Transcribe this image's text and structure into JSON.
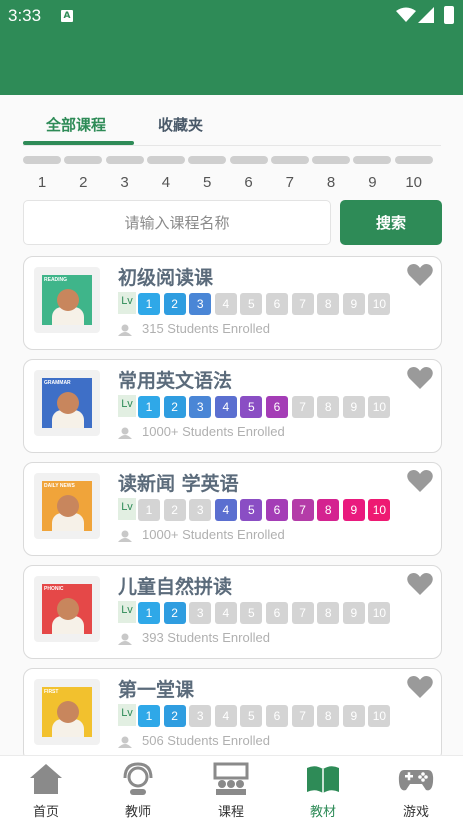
{
  "status_bar": {
    "time": "3:33",
    "notification_icon": "A"
  },
  "tabs": [
    {
      "label": "全部课程",
      "active": true
    },
    {
      "label": "收藏夹",
      "active": false
    }
  ],
  "level_filter": {
    "levels": [
      "1",
      "2",
      "3",
      "4",
      "5",
      "6",
      "7",
      "8",
      "9",
      "10"
    ]
  },
  "search": {
    "placeholder": "请输入课程名称",
    "button_label": "搜索"
  },
  "colors": {
    "brand": "#2e8b57",
    "lv1": "#2fa8e8",
    "lv2": "#2f9de0",
    "lv3": "#4a86d6",
    "lv4": "#5b6fd0",
    "lv5": "#8a4ec4",
    "lv6": "#a43db6",
    "lv7": "#b43ca8",
    "lv8": "#d42390",
    "lv9": "#e91a7e",
    "lv10": "#ee1a72",
    "inactive": "#d4d4d4"
  },
  "courses": [
    {
      "title": "初级阅读课",
      "lv_label": "Lv",
      "cover_tag": "READING",
      "cover_bg": "#3fb58a",
      "active_levels": [
        1,
        2,
        3
      ],
      "enrolled": "315 Students Enrolled"
    },
    {
      "title": "常用英文语法",
      "lv_label": "Lv",
      "cover_tag": "GRAMMAR",
      "cover_bg": "#3e6fc7",
      "active_levels": [
        1,
        2,
        3,
        4,
        5,
        6
      ],
      "enrolled": "1000+ Students Enrolled"
    },
    {
      "title": "读新闻 学英语",
      "lv_label": "Lv",
      "cover_tag": "DAILY NEWS",
      "cover_bg": "#f0a43a",
      "active_levels": [
        4,
        5,
        6,
        7,
        8,
        9,
        10
      ],
      "enrolled": "1000+ Students Enrolled"
    },
    {
      "title": "儿童自然拼读",
      "lv_label": "Lv",
      "cover_tag": "PHONIC",
      "cover_bg": "#e54848",
      "active_levels": [
        1,
        2
      ],
      "enrolled": "393 Students Enrolled"
    },
    {
      "title": "第一堂课",
      "lv_label": "Lv",
      "cover_tag": "FIRST",
      "cover_bg": "#f2c12e",
      "active_levels": [
        1,
        2
      ],
      "enrolled": "506 Students Enrolled"
    }
  ],
  "bottom_nav": [
    {
      "label": "首页",
      "icon": "home-icon",
      "active": false
    },
    {
      "label": "教师",
      "icon": "teacher-icon",
      "active": false
    },
    {
      "label": "课程",
      "icon": "classroom-icon",
      "active": false
    },
    {
      "label": "教材",
      "icon": "book-icon",
      "active": true
    },
    {
      "label": "游戏",
      "icon": "gamepad-icon",
      "active": false
    }
  ]
}
